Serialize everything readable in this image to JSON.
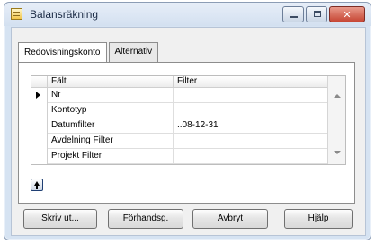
{
  "window": {
    "title": "Balansräkning"
  },
  "tabs": [
    {
      "label": "Redovisningskonto",
      "active": true
    },
    {
      "label": "Alternativ",
      "active": false
    }
  ],
  "grid": {
    "headers": {
      "field": "Fält",
      "filter": "Filter"
    },
    "rows": [
      {
        "field": "Nr",
        "filter": "",
        "selected": true
      },
      {
        "field": "Kontotyp",
        "filter": ""
      },
      {
        "field": "Datumfilter",
        "filter": "..08-12-31"
      },
      {
        "field": "Avdelning Filter",
        "filter": ""
      },
      {
        "field": "Projekt Filter",
        "filter": ""
      }
    ]
  },
  "buttons": {
    "print": "Skriv ut...",
    "preview": "Förhandsg.",
    "cancel": "Avbryt",
    "help": "Hjälp"
  },
  "icons": {
    "app": "balance-sheet-icon",
    "up": "up-arrow-icon",
    "minimize": "minimize-icon",
    "maximize": "maximize-icon",
    "close": "close-icon"
  }
}
